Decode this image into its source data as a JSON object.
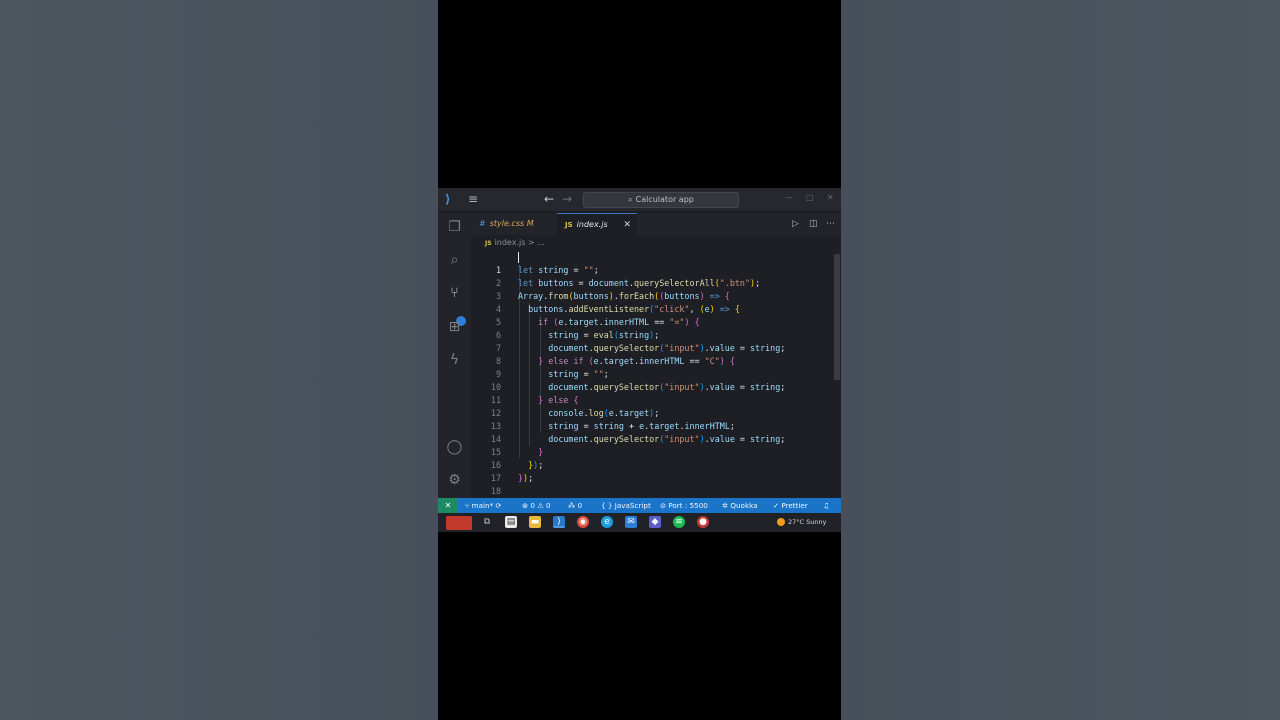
{
  "window": {
    "title": "Calculator app",
    "menu_icon": "hamburger-icon",
    "back_icon": "←",
    "forward_icon": "→"
  },
  "tabs": [
    {
      "label": "style.css M",
      "icon": "#"
    },
    {
      "label": "index.js",
      "icon": "JS",
      "close": "✕"
    }
  ],
  "breadcrumb": {
    "file": "index.js",
    "rest": "> ..."
  },
  "editor": {
    "current_line": 1,
    "line_numbers": [
      "1",
      "2",
      "3",
      "4",
      "5",
      "6",
      "7",
      "8",
      "9",
      "10",
      "11",
      "12",
      "13",
      "14",
      "15",
      "16",
      "17",
      "18"
    ]
  },
  "statusbar": {
    "branch": "main*",
    "errors": "0",
    "warnings": "0",
    "ports_label": "0",
    "language": "JavaScript",
    "port": "Port : 5500",
    "quokka": "Quokka",
    "prettier": "Prettier"
  },
  "taskbar": {
    "weather": "27°C Sunny"
  },
  "colors": {
    "status_bar": "#1a74c8",
    "remote_indicator": "#1e8a63",
    "editor_bg": "#1e1f24",
    "keyword": "#c586c0",
    "function": "#dcdcaa",
    "string": "#ce9178"
  }
}
